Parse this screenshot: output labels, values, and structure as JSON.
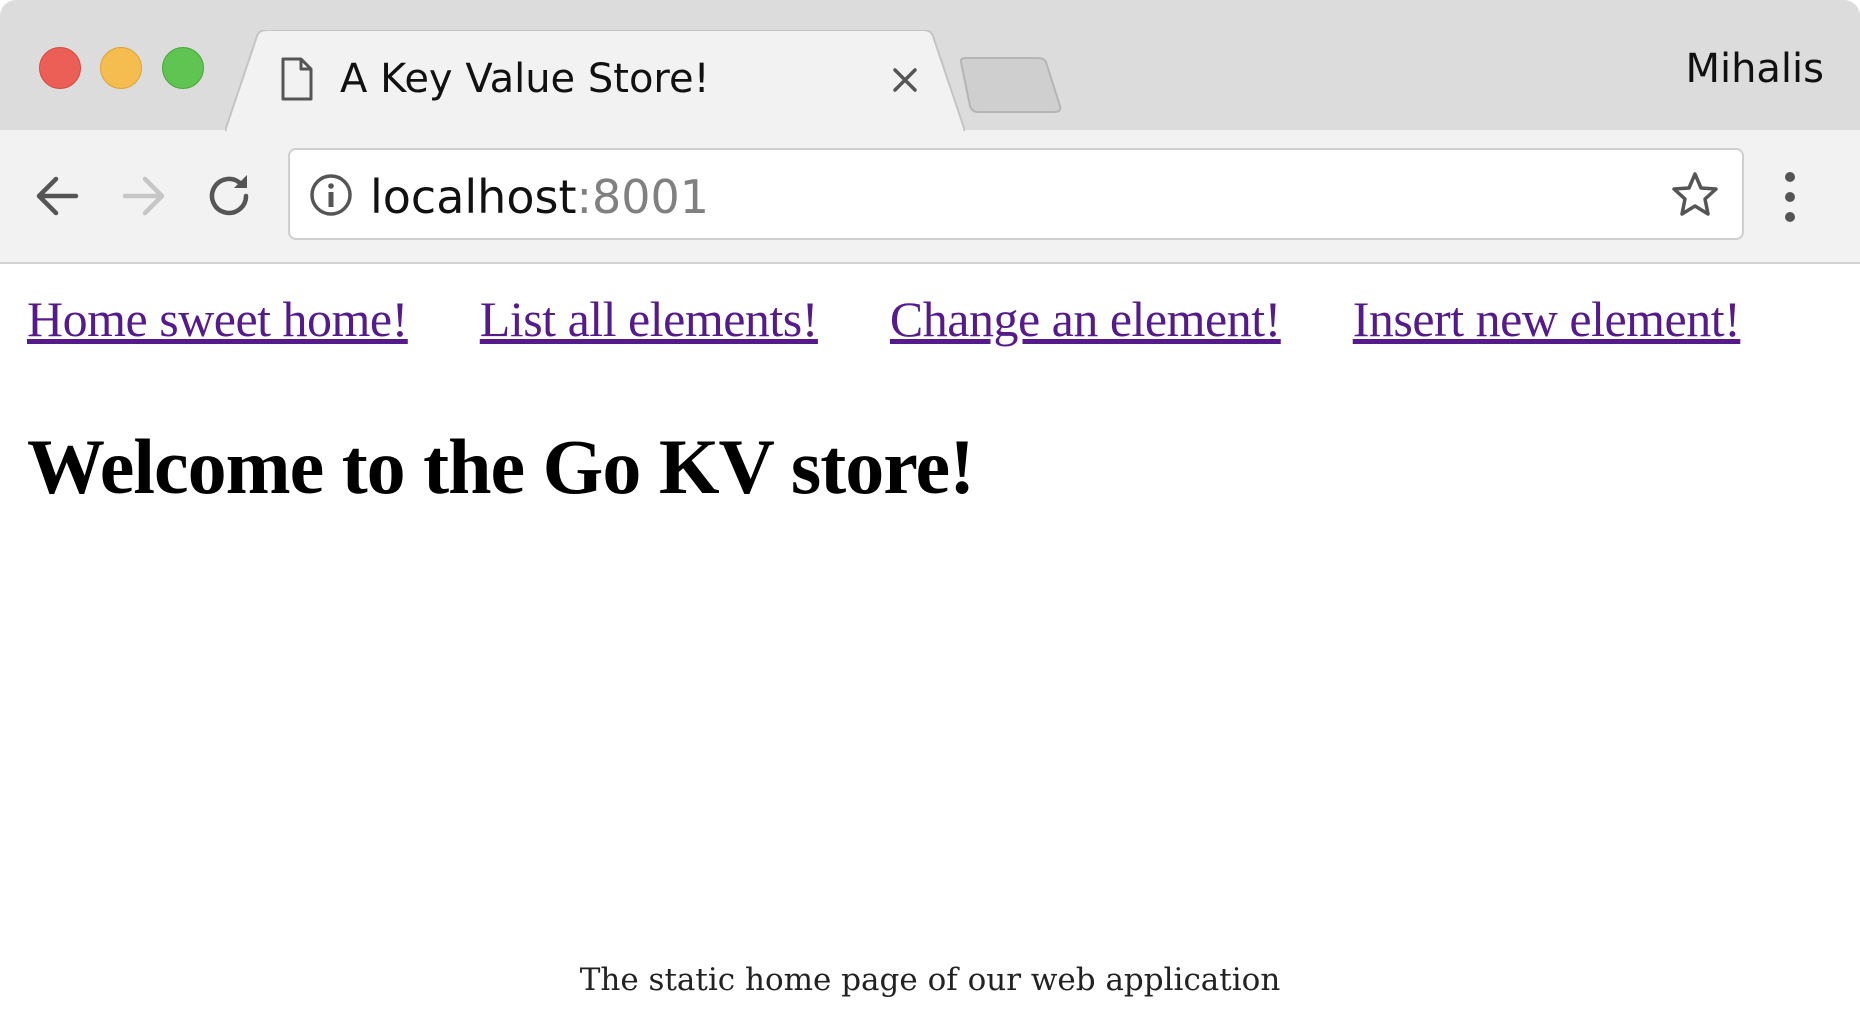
{
  "browser": {
    "tab": {
      "title": "A Key Value Store!"
    },
    "profile_name": "Mihalis",
    "address_bar": {
      "host": "localhost",
      "port": ":8001"
    },
    "icons": [
      "back-arrow-icon",
      "forward-arrow-icon",
      "reload-icon",
      "info-icon",
      "star-icon",
      "more-vert-icon",
      "document-icon",
      "close-icon"
    ]
  },
  "page": {
    "nav_links": [
      {
        "label": "Home sweet home!"
      },
      {
        "label": "List all elements!"
      },
      {
        "label": "Change an element!"
      },
      {
        "label": "Insert new element!"
      }
    ],
    "heading": "Welcome to the Go KV store!",
    "link_color": "#551a8b"
  },
  "caption": "The static home page of our web application"
}
